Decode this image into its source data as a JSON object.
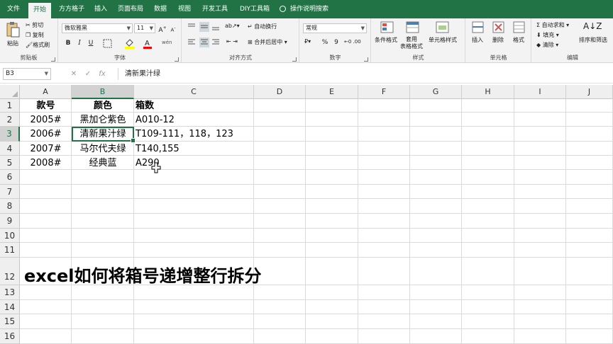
{
  "ribbon_tabs": [
    "文件",
    "开始",
    "方方格子",
    "插入",
    "页面布局",
    "数据",
    "视图",
    "开发工具",
    "DIY工具箱"
  ],
  "tell_me": "操作说明搜索",
  "clipboard": {
    "paste": "粘贴",
    "cut": "剪切",
    "copy": "复制",
    "format_painter": "格式刷",
    "label": "剪贴板"
  },
  "font": {
    "name": "微软雅黑",
    "size": "11",
    "grow": "A",
    "shrink": "A",
    "bold": "B",
    "italic": "I",
    "underline": "U",
    "wen": "wén",
    "label": "字体"
  },
  "alignment": {
    "wrap": "自动换行",
    "merge": "合并后居中",
    "label": "对齐方式"
  },
  "number": {
    "format": "常规",
    "percent": "%",
    "comma": "9",
    "label": "数字"
  },
  "styles": {
    "conditional": "条件格式",
    "table": "套用\n表格格式",
    "cell_styles": "单元格样式",
    "label": "样式"
  },
  "cells": {
    "insert": "插入",
    "delete": "删除",
    "format": "格式",
    "label": "单元格"
  },
  "editing": {
    "autosum": "自动求和",
    "fill": "填充",
    "clear": "清除",
    "sort": "排序和筛选",
    "label": "编辑"
  },
  "formula_bar": {
    "name_box": "B3",
    "cancel": "✕",
    "enter": "✓",
    "fx": "fx",
    "content": "清新果汁绿"
  },
  "columns": [
    "A",
    "B",
    "C",
    "D",
    "E",
    "F",
    "G",
    "H",
    "I",
    "J"
  ],
  "rows": [
    "1",
    "2",
    "3",
    "4",
    "5",
    "6",
    "7",
    "8",
    "9",
    "10",
    "11",
    "12",
    "13",
    "14",
    "15",
    "16"
  ],
  "cells_data": {
    "A1": "款号",
    "B1": "颜色",
    "C1": "箱数",
    "A2": "2005#",
    "B2": "黑加仑紫色",
    "C2": "A010-12",
    "A3": "2006#",
    "B3": "清新果汁绿",
    "C3": "T109-111，118，123",
    "A4": "2007#",
    "B4": "马尔代夫绿",
    "C4": "T140,155",
    "A5": "2008#",
    "B5": "经典蓝",
    "C5": "A290"
  },
  "title_text": "excel如何将箱号递增整行拆分",
  "colors": {
    "brand": "#217346",
    "ribbon_bg": "#f3f3f3"
  }
}
